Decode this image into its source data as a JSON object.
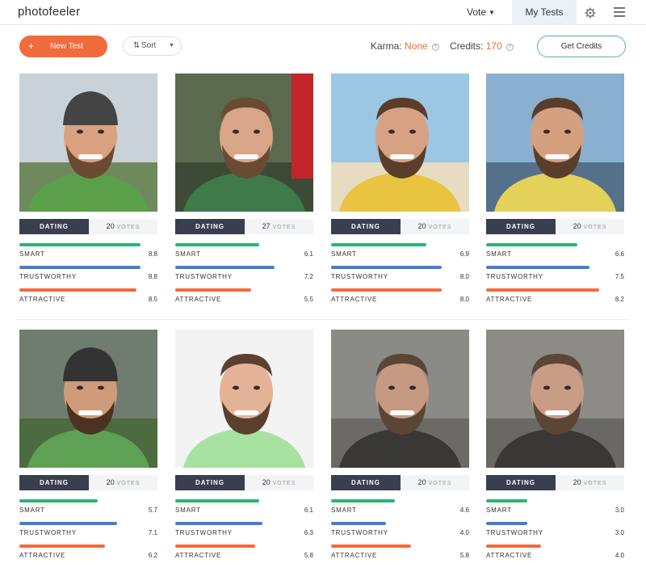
{
  "header": {
    "logo": "photofeeler",
    "vote_label": "Vote",
    "my_tests_label": "My Tests",
    "icons": [
      "gear-icon",
      "hamburger-menu-icon"
    ]
  },
  "toolbar": {
    "new_test_label": "New Test",
    "sort_label": "Sort",
    "karma_label": "Karma:",
    "karma_value": "None",
    "credits_label": "Credits:",
    "credits_value": "170",
    "get_credits_label": "Get Credits"
  },
  "colors": {
    "accent": "#f26b3d",
    "smart": "#2bb673",
    "trustworthy": "#4a7bd0",
    "attractive": "#f26b3d",
    "dating_tab": "#3a3f4f"
  },
  "labels": {
    "dating": "DATING",
    "votes": "VOTES",
    "smart": "SMART",
    "trustworthy": "TRUSTWORTHY",
    "attractive": "ATTRACTIVE"
  },
  "tests": [
    {
      "votes": "20",
      "smart": "8.8",
      "trustworthy": "8.8",
      "attractive": "8.5"
    },
    {
      "votes": "27",
      "smart": "6.1",
      "trustworthy": "7.2",
      "attractive": "5.5"
    },
    {
      "votes": "20",
      "smart": "6.9",
      "trustworthy": "8.0",
      "attractive": "8.0"
    },
    {
      "votes": "20",
      "smart": "6.6",
      "trustworthy": "7.5",
      "attractive": "8.2"
    },
    {
      "votes": "20",
      "smart": "5.7",
      "trustworthy": "7.1",
      "attractive": "6.2"
    },
    {
      "votes": "20",
      "smart": "6.1",
      "trustworthy": "6.3",
      "attractive": "5.8"
    },
    {
      "votes": "20",
      "smart": "4.6",
      "trustworthy": "4.0",
      "attractive": "5.8"
    },
    {
      "votes": "20",
      "smart": "3.0",
      "trustworthy": "3.0",
      "attractive": "4.0"
    }
  ]
}
